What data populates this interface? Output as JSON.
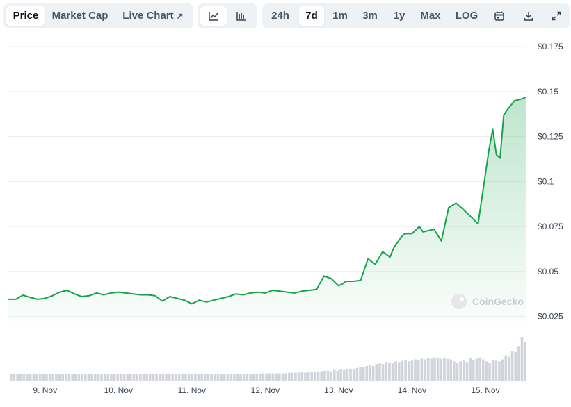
{
  "toolbar": {
    "metric_tabs": [
      {
        "label": "Price",
        "active": true
      },
      {
        "label": "Market Cap",
        "active": false
      },
      {
        "label": "Live Chart",
        "active": false
      }
    ],
    "chart_type_buttons": [
      {
        "icon": "line-chart-icon",
        "active": true
      },
      {
        "icon": "candlestick-chart-icon",
        "active": false
      }
    ],
    "range_tabs": [
      {
        "label": "24h",
        "active": false
      },
      {
        "label": "7d",
        "active": true
      },
      {
        "label": "1m",
        "active": false
      },
      {
        "label": "3m",
        "active": false
      },
      {
        "label": "1y",
        "active": false
      },
      {
        "label": "Max",
        "active": false
      },
      {
        "label": "LOG",
        "active": false
      }
    ],
    "tool_icons": [
      "calendar-icon",
      "download-icon",
      "expand-icon"
    ]
  },
  "watermark": "CoinGecko",
  "colors": {
    "line": "#16a34a",
    "volume": "#d1d5db",
    "grid": "#eceef1"
  },
  "chart_data": {
    "type": "line",
    "title": "",
    "ylabel": "",
    "xlabel": "",
    "y_ticks": [
      "$0.175",
      "$0.15",
      "$0.125",
      "$0.1",
      "$0.075",
      "$0.05",
      "$0.025"
    ],
    "y_tick_values": [
      0.175,
      0.15,
      0.125,
      0.1,
      0.075,
      0.05,
      0.025
    ],
    "ylim": [
      0.0225,
      0.1855
    ],
    "x_ticks": [
      "9. Nov",
      "10. Nov",
      "11. Nov",
      "12. Nov",
      "13. Nov",
      "14. Nov",
      "15. Nov"
    ],
    "x_tick_days": [
      9,
      10,
      11,
      12,
      13,
      14,
      15
    ],
    "xlim_days": [
      8.5,
      15.56
    ],
    "grid": true,
    "series": [
      {
        "x_days": [
          8.5,
          8.6,
          8.7,
          8.8,
          8.9,
          9.0,
          9.1,
          9.2,
          9.3,
          9.4,
          9.5,
          9.6,
          9.7,
          9.8,
          9.9,
          10.0,
          10.1,
          10.2,
          10.3,
          10.4,
          10.5,
          10.6,
          10.7,
          10.8,
          10.9,
          11.0,
          11.1,
          11.2,
          11.3,
          11.4,
          11.5,
          11.6,
          11.7,
          11.8,
          11.9,
          12.0,
          12.1,
          12.2,
          12.3,
          12.4,
          12.5,
          12.6,
          12.7,
          12.8,
          12.9,
          13.0,
          13.05,
          13.1,
          13.2,
          13.3,
          13.35,
          13.4,
          13.5,
          13.6,
          13.7,
          13.75,
          13.8,
          13.85,
          13.9,
          14.0,
          14.1,
          14.15,
          14.2,
          14.3,
          14.4,
          14.5,
          14.6,
          14.7,
          14.8,
          14.9,
          15.0,
          15.05,
          15.1,
          15.15,
          15.2,
          15.25,
          15.3,
          15.4,
          15.5,
          15.55
        ],
        "values": [
          0.0345,
          0.0345,
          0.0368,
          0.0355,
          0.0345,
          0.035,
          0.0365,
          0.0385,
          0.0395,
          0.0375,
          0.036,
          0.0365,
          0.038,
          0.037,
          0.038,
          0.0385,
          0.038,
          0.0375,
          0.037,
          0.037,
          0.0365,
          0.0335,
          0.036,
          0.035,
          0.034,
          0.032,
          0.034,
          0.033,
          0.034,
          0.035,
          0.036,
          0.0375,
          0.037,
          0.038,
          0.0385,
          0.038,
          0.0395,
          0.039,
          0.0385,
          0.038,
          0.039,
          0.0395,
          0.04,
          0.0475,
          0.046,
          0.042,
          0.043,
          0.0445,
          0.0445,
          0.045,
          0.051,
          0.057,
          0.054,
          0.061,
          0.058,
          0.063,
          0.066,
          0.069,
          0.071,
          0.071,
          0.075,
          0.072,
          0.0725,
          0.0735,
          0.067,
          0.0855,
          0.088,
          0.0845,
          0.0805,
          0.0765,
          0.104,
          0.118,
          0.129,
          0.115,
          0.113,
          0.137,
          0.14,
          0.145,
          0.146,
          0.147
        ]
      }
    ],
    "volume": [
      1,
      1,
      1,
      1,
      1,
      1,
      1,
      1,
      1,
      1,
      1,
      1,
      1,
      1,
      1,
      1,
      1,
      1,
      1,
      1,
      1,
      1,
      1,
      1,
      1,
      1,
      1,
      1,
      1,
      1,
      1,
      1,
      1,
      1,
      1,
      1,
      1,
      1,
      1,
      1,
      1,
      1,
      1,
      1,
      1,
      1,
      1,
      1,
      1,
      1,
      1,
      1,
      1,
      1,
      1,
      1,
      1,
      1,
      1,
      1,
      1,
      1,
      1,
      1,
      1,
      1,
      1,
      1,
      1,
      1,
      1,
      1,
      1,
      1,
      1,
      1,
      1,
      1,
      1.1,
      1.1,
      1.1,
      1.1,
      1.1,
      1.1,
      1.1,
      1.1,
      1.2,
      1.2,
      1.2,
      1.2,
      1.3,
      1.2,
      1.3,
      1.3,
      1.4,
      1.3,
      1.4,
      1.5,
      1.5,
      1.4,
      1.6,
      1.5,
      1.7,
      1.6,
      1.7,
      1.8,
      1.7,
      1.9,
      2.0,
      2.1,
      2.2,
      2.4,
      2.2,
      2.5,
      2.6,
      2.5,
      2.8,
      2.7,
      2.6,
      2.9,
      2.8,
      3.0,
      3.1,
      2.9,
      3.0,
      3.2,
      3.1,
      3.3,
      3.2,
      3.4,
      3.3,
      3.5,
      3.4,
      3.3,
      3.4,
      3.3,
      3.2,
      2.9,
      2.6,
      2.9,
      3.0,
      2.8,
      3.4,
      3.1,
      3.3,
      3.5,
      3.2,
      2.9,
      2.7,
      3.1,
      3.0,
      2.9,
      3.2,
      3.8,
      3.6,
      4.5,
      4.3,
      5.2,
      6.6,
      5.8
    ]
  }
}
